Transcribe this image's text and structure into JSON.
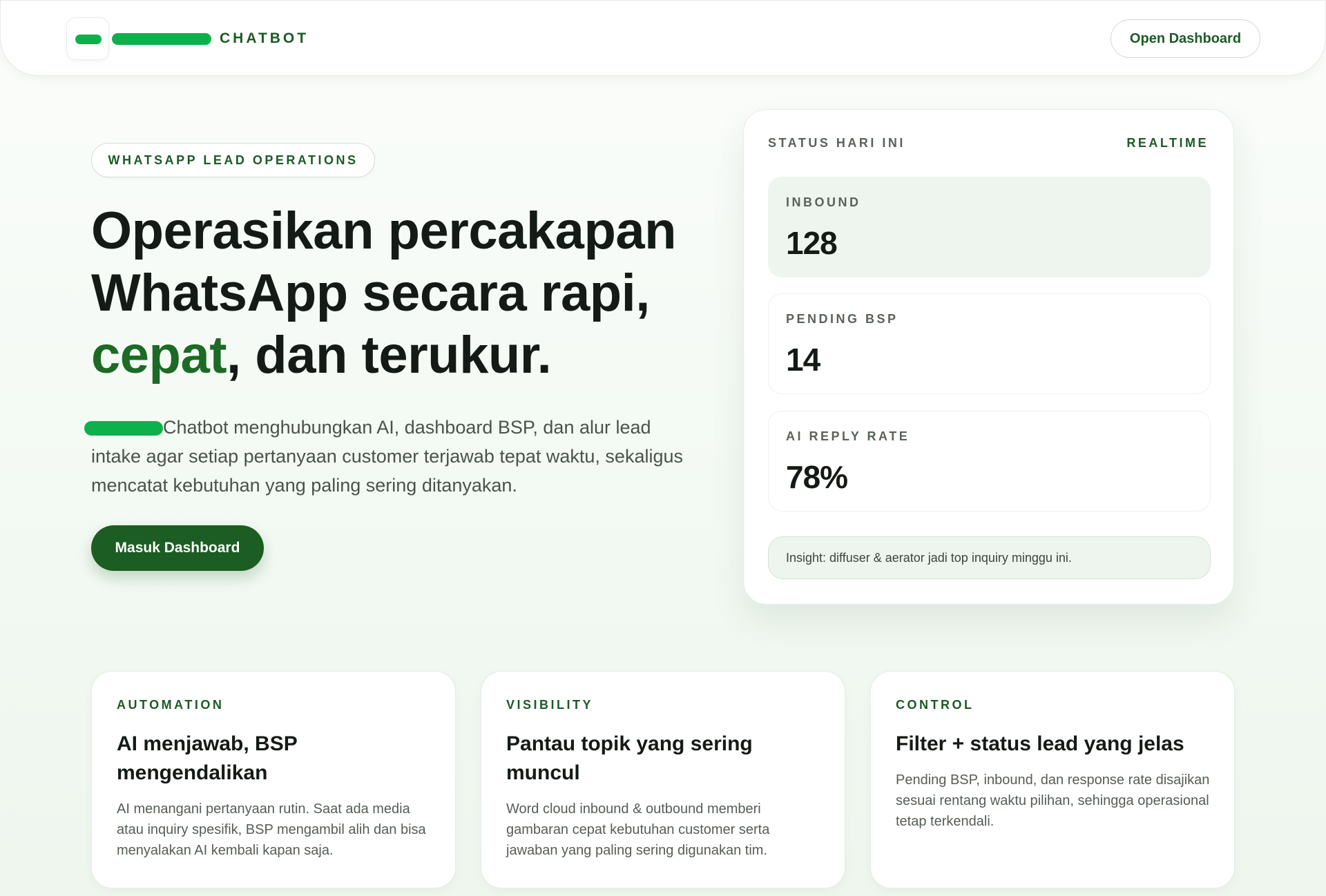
{
  "colors": {
    "accent": "#1b5d22",
    "brand_green": "#0db14b",
    "background": "#f3f9f3"
  },
  "header": {
    "brand_name": "CHATBOT",
    "logo_icon": "logo-icon",
    "open_dashboard_label": "Open Dashboard"
  },
  "hero": {
    "eyebrow": "WHATSAPP LEAD OPERATIONS",
    "headline_line1": "Operasikan percakapan",
    "headline_line2": "WhatsApp secara rapi,",
    "headline_accent": "cepat",
    "headline_line3_rest": ", dan terukur.",
    "description": "Chatbot menghubungkan AI, dashboard BSP, dan alur lead intake agar setiap pertanyaan customer terjawab tepat waktu, sekaligus mencatat kebutuhan yang paling sering ditanyakan.",
    "cta_label": "Masuk Dashboard"
  },
  "status": {
    "title": "STATUS HARI INI",
    "live_label": "REALTIME",
    "metrics": [
      {
        "label": "INBOUND",
        "value": "128"
      },
      {
        "label": "PENDING BSP",
        "value": "14"
      },
      {
        "label": "AI REPLY RATE",
        "value": "78%"
      }
    ],
    "insight": "Insight: diffuser & aerator jadi top inquiry minggu ini."
  },
  "features": [
    {
      "eyebrow": "AUTOMATION",
      "title": "AI menjawab, BSP mengendalikan",
      "description": "AI menangani pertanyaan rutin. Saat ada media atau inquiry spesifik, BSP mengambil alih dan bisa menyalakan AI kembali kapan saja."
    },
    {
      "eyebrow": "VISIBILITY",
      "title": "Pantau topik yang sering muncul",
      "description": "Word cloud inbound & outbound memberi gambaran cepat kebutuhan customer serta jawaban yang paling sering digunakan tim."
    },
    {
      "eyebrow": "CONTROL",
      "title": "Filter + status lead yang jelas",
      "description": "Pending BSP, inbound, dan response rate disajikan sesuai rentang waktu pilihan, sehingga operasional tetap terkendali."
    }
  ]
}
